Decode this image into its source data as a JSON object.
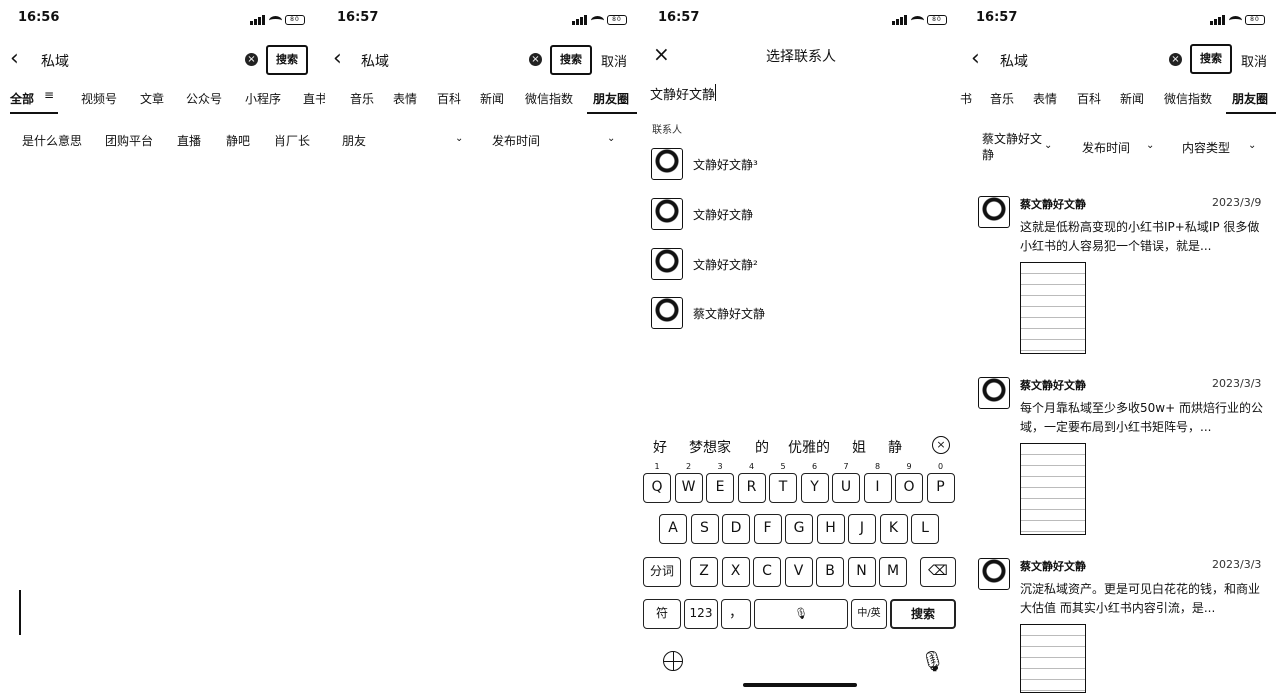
{
  "panel1": {
    "time": "16:56",
    "query": "私域",
    "search_label": "搜索",
    "tabs": [
      "全部",
      "视频号",
      "文章",
      "公众号",
      "小程序",
      "直书"
    ],
    "suggestions": [
      "是什么意思",
      "团购平台",
      "直播",
      "静吧",
      "肖厂长"
    ]
  },
  "panel2": {
    "time": "16:57",
    "query": "私域",
    "search_label": "搜索",
    "cancel": "取消",
    "tabs": [
      "音乐",
      "表情",
      "百科",
      "新闻",
      "微信指数",
      "朋友圈"
    ],
    "filters": [
      "朋友",
      "发布时间"
    ]
  },
  "panel3": {
    "time": "16:57",
    "title": "选择联系人",
    "input_value": "文静好文静",
    "contacts_label": "联系人",
    "contacts": [
      "文静好文静³",
      "文静好文静",
      "文静好文静²",
      "蔡文静好文静"
    ],
    "candidates": [
      "好",
      "梦想家",
      "的",
      "优雅的",
      "姐",
      "静"
    ],
    "kb_nums": [
      "1",
      "2",
      "3",
      "4",
      "5",
      "6",
      "7",
      "8",
      "9",
      "0"
    ],
    "kb_row1": [
      "Q",
      "W",
      "E",
      "R",
      "T",
      "Y",
      "U",
      "I",
      "O",
      "P"
    ],
    "kb_row2": [
      "A",
      "S",
      "D",
      "F",
      "G",
      "H",
      "J",
      "K",
      "L"
    ],
    "kb_row3": [
      "Z",
      "X",
      "C",
      "V",
      "B",
      "N",
      "M"
    ],
    "kb_fenci": "分词",
    "kb_fu": "符",
    "kb_123": "123",
    "kb_punct": "，",
    "kb_zhong": "中/英",
    "kb_search": "搜索"
  },
  "panel4": {
    "time": "16:57",
    "query": "私域",
    "search_label": "搜索",
    "cancel": "取消",
    "tabs": [
      "书",
      "音乐",
      "表情",
      "百科",
      "新闻",
      "微信指数",
      "朋友圈"
    ],
    "filters": [
      "蔡文静好文静",
      "发布时间",
      "内容类型"
    ],
    "posts": [
      {
        "author": "蔡文静好文静",
        "date": "2023/3/9",
        "text": "这就是低粉高变现的小红书IP+私域IP 很多做小红书的人容易犯一个错误，就是..."
      },
      {
        "author": "蔡文静好文静",
        "date": "2023/3/3",
        "text": "每个月靠私域至少多收50w+ 而烘焙行业的公域，一定要布局到小红书矩阵号，..."
      },
      {
        "author": "蔡文静好文静",
        "date": "2023/3/3",
        "text": "沉淀私域资产。更是可见白花花的钱，和商业大估值 而其实小红书内容引流，是..."
      }
    ]
  },
  "icons": {
    "back": "back-arrow-icon",
    "clear": "clear-icon",
    "close": "close-icon",
    "filter": "filter-icon",
    "chevron": "chevron-down-icon",
    "backspace": "backspace-icon",
    "globe": "globe-icon",
    "mic": "microphone-icon",
    "signal": "signal-icon",
    "wifi": "wifi-icon",
    "battery": "battery-icon"
  },
  "battery_label": "80"
}
